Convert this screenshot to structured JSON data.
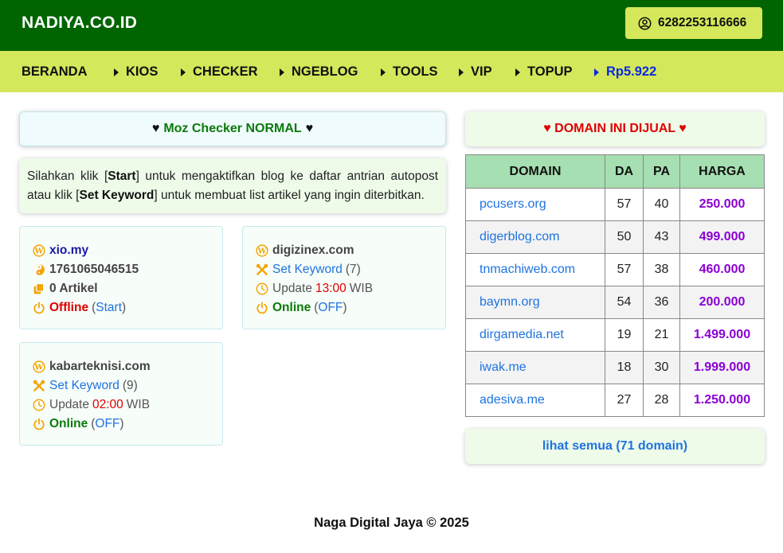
{
  "header": {
    "brand": "NADIYA.CO.ID",
    "phone": "6282253116666"
  },
  "nav": {
    "home": "BERANDA",
    "items": [
      "KIOS",
      "CHECKER",
      "NGEBLOG",
      "TOOLS",
      "VIP",
      "TOPUP"
    ],
    "balance": "Rp5.922"
  },
  "moz": {
    "heart": "♥",
    "title": "Moz Checker NORMAL"
  },
  "info": {
    "t1": "Silahkan klik [",
    "start": "Start",
    "t2": "] untuk mengaktifkan blog ke daftar antrian autopost atau klik [",
    "setkw": "Set Keyword",
    "t3": "] untuk membuat list artikel yang ingin diterbitkan."
  },
  "blogs": [
    {
      "name": "xio.my",
      "id": "1761065046515",
      "articles": "0 Artikel",
      "status": "Offline",
      "action": "Start"
    },
    {
      "name": "digizinex.com",
      "keyword_label": "Set Keyword",
      "keyword_count": "(7)",
      "update_label": "Update",
      "update_time": "13:00",
      "tz": "WIB",
      "status": "Online",
      "action": "OFF"
    },
    {
      "name": "kabarteknisi.com",
      "keyword_label": "Set Keyword",
      "keyword_count": "(9)",
      "update_label": "Update",
      "update_time": "02:00",
      "tz": "WIB",
      "status": "Online",
      "action": "OFF"
    }
  ],
  "sale": {
    "title": "♥ DOMAIN INI DIJUAL ♥",
    "columns": [
      "DOMAIN",
      "DA",
      "PA",
      "HARGA"
    ],
    "rows": [
      [
        "pcusers.org",
        "57",
        "40",
        "250.000"
      ],
      [
        "digerblog.com",
        "50",
        "43",
        "499.000"
      ],
      [
        "tnmachiweb.com",
        "57",
        "38",
        "460.000"
      ],
      [
        "baymn.org",
        "54",
        "36",
        "200.000"
      ],
      [
        "dirgamedia.net",
        "19",
        "21",
        "1.499.000"
      ],
      [
        "iwak.me",
        "18",
        "30",
        "1.999.000"
      ],
      [
        "adesiva.me",
        "27",
        "28",
        "1.250.000"
      ]
    ],
    "see_all": "lihat semua (71 domain)"
  },
  "footer": "Naga Digital Jaya © 2025",
  "colors": {
    "header": "#006400",
    "nav": "#d5e75a",
    "accent_blue": "#1f73e0",
    "price_purple": "#8a00d4",
    "warn_red": "#e00000",
    "ok_green": "#0a7a0a",
    "icon_orange": "#f5a400"
  }
}
